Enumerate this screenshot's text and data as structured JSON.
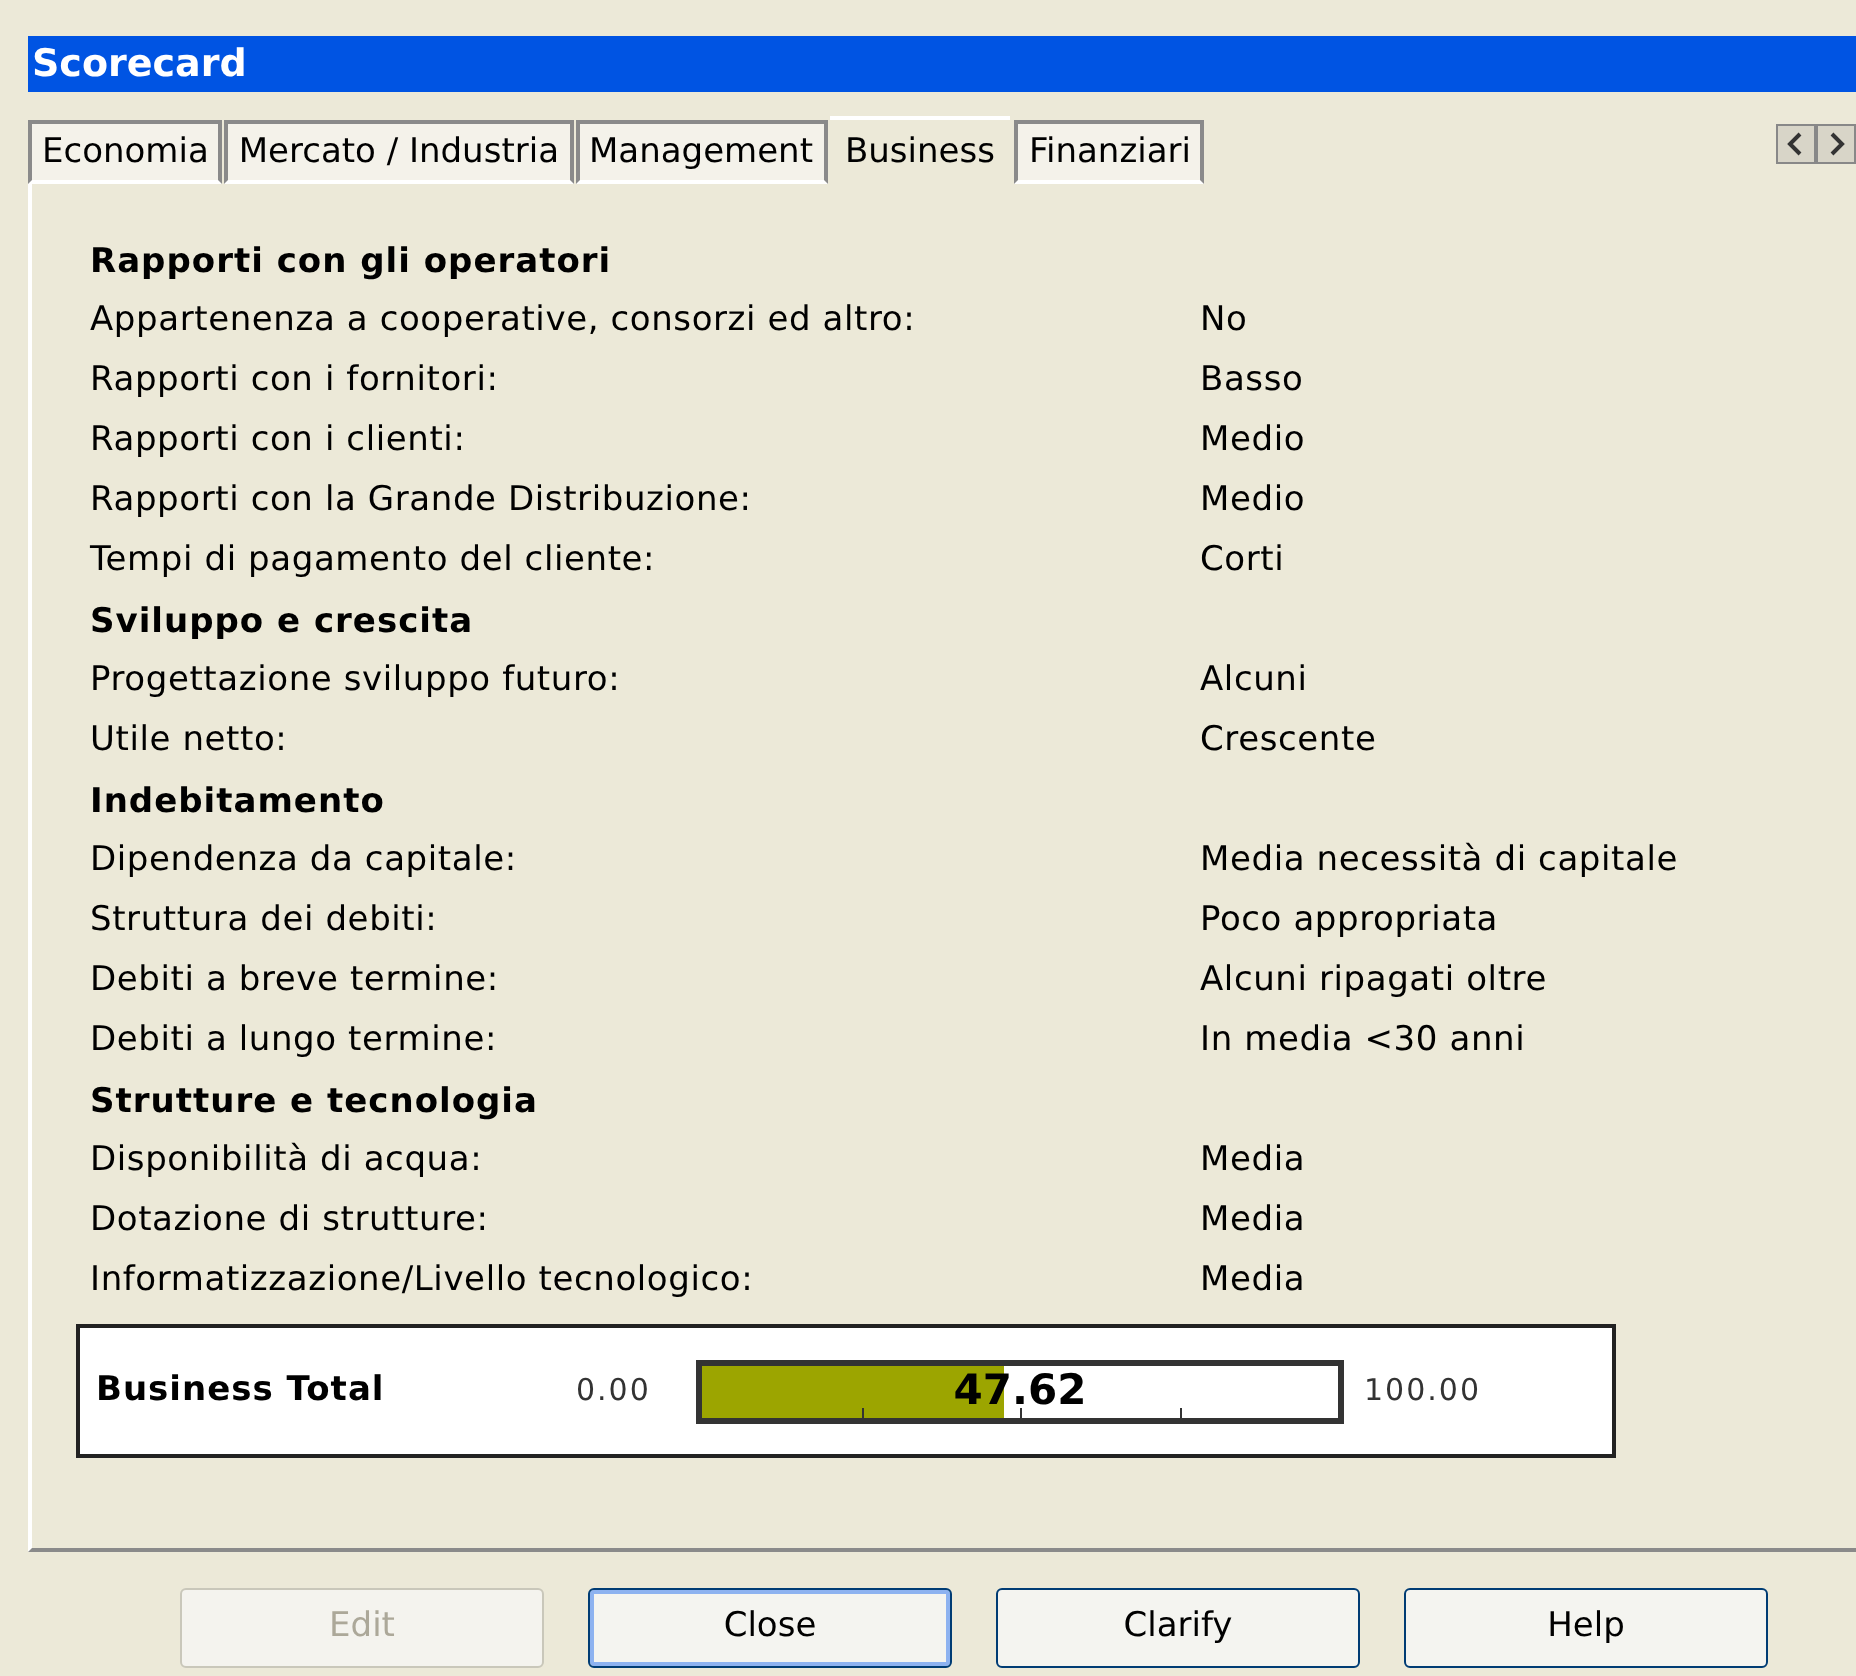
{
  "window": {
    "title": "Scorecard"
  },
  "tabs": [
    {
      "label": "Economia",
      "selected": false
    },
    {
      "label": "Mercato / Industria",
      "selected": false
    },
    {
      "label": "Management",
      "selected": false
    },
    {
      "label": "Business",
      "selected": true
    },
    {
      "label": "Finanziari",
      "selected": false
    }
  ],
  "sections": [
    {
      "title": "Rapporti con gli operatori",
      "rows": [
        {
          "label": "Appartenenza a cooperative, consorzi ed altro:",
          "value": "No"
        },
        {
          "label": "Rapporti con i fornitori:",
          "value": "Basso"
        },
        {
          "label": "Rapporti con i clienti:",
          "value": "Medio"
        },
        {
          "label": "Rapporti con la Grande Distribuzione:",
          "value": "Medio"
        },
        {
          "label": "Tempi di pagamento del cliente:",
          "value": "Corti"
        }
      ]
    },
    {
      "title": "Sviluppo e crescita",
      "rows": [
        {
          "label": "Progettazione sviluppo futuro:",
          "value": "Alcuni"
        },
        {
          "label": "Utile netto:",
          "value": "Crescente"
        }
      ]
    },
    {
      "title": "Indebitamento",
      "rows": [
        {
          "label": "Dipendenza da capitale:",
          "value": "Media necessità di capitale"
        },
        {
          "label": "Struttura dei debiti:",
          "value": "Poco appropriata"
        },
        {
          "label": "Debiti a breve termine:",
          "value": "Alcuni ripagati oltre"
        },
        {
          "label": "Debiti a lungo termine:",
          "value": "In media <30 anni"
        }
      ]
    },
    {
      "title": "Strutture e tecnologia",
      "rows": [
        {
          "label": "Disponibilità di acqua:",
          "value": "Media"
        },
        {
          "label": "Dotazione di strutture:",
          "value": "Media"
        },
        {
          "label": "Informatizzazione/Livello tecnologico:",
          "value": "Media"
        }
      ]
    }
  ],
  "total": {
    "label": "Business Total",
    "min": "0.00",
    "max": "100.00",
    "reading": "47.62",
    "level": 0.4762
  },
  "buttons": [
    {
      "label": "Edit",
      "disabled": true,
      "selected": false
    },
    {
      "label": "Close",
      "disabled": false,
      "selected": true
    },
    {
      "label": "Clarify",
      "disabled": false,
      "selected": false
    },
    {
      "label": "Help",
      "disabled": false,
      "selected": false
    }
  ]
}
